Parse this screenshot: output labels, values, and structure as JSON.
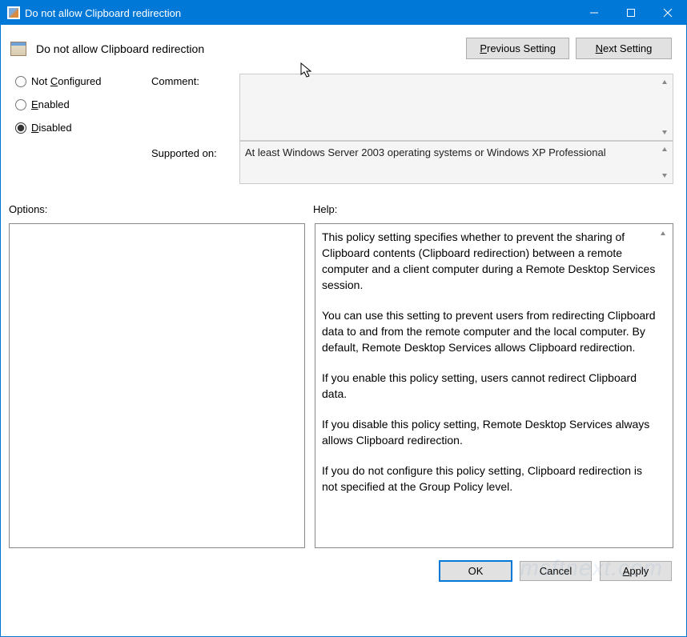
{
  "window": {
    "title": "Do not allow Clipboard redirection"
  },
  "header": {
    "policy_title": "Do not allow Clipboard redirection",
    "previous": "Previous Setting",
    "next": "Next Setting"
  },
  "radios": {
    "not_configured": "Not Configured",
    "enabled": "Enabled",
    "disabled": "Disabled",
    "selected": "disabled"
  },
  "fields": {
    "comment_label": "Comment:",
    "comment_value": "",
    "supported_label": "Supported on:",
    "supported_value": "At least Windows Server 2003 operating systems or Windows XP Professional"
  },
  "labels": {
    "options": "Options:",
    "help": "Help:"
  },
  "help_text": {
    "p1": "This policy setting specifies whether to prevent the sharing of Clipboard contents (Clipboard redirection) between a remote computer and a client computer during a Remote Desktop Services session.",
    "p2": "You can use this setting to prevent users from redirecting Clipboard data to and from the remote computer and the local computer. By default, Remote Desktop Services allows Clipboard redirection.",
    "p3": "If you enable this policy setting, users cannot redirect Clipboard data.",
    "p4": "If you disable this policy setting, Remote Desktop Services always allows Clipboard redirection.",
    "p5": "If you do not configure this policy setting, Clipboard redirection is not specified at the Group Policy level."
  },
  "buttons": {
    "ok": "OK",
    "cancel": "Cancel",
    "apply": "Apply"
  },
  "watermark": "msftnext.com"
}
